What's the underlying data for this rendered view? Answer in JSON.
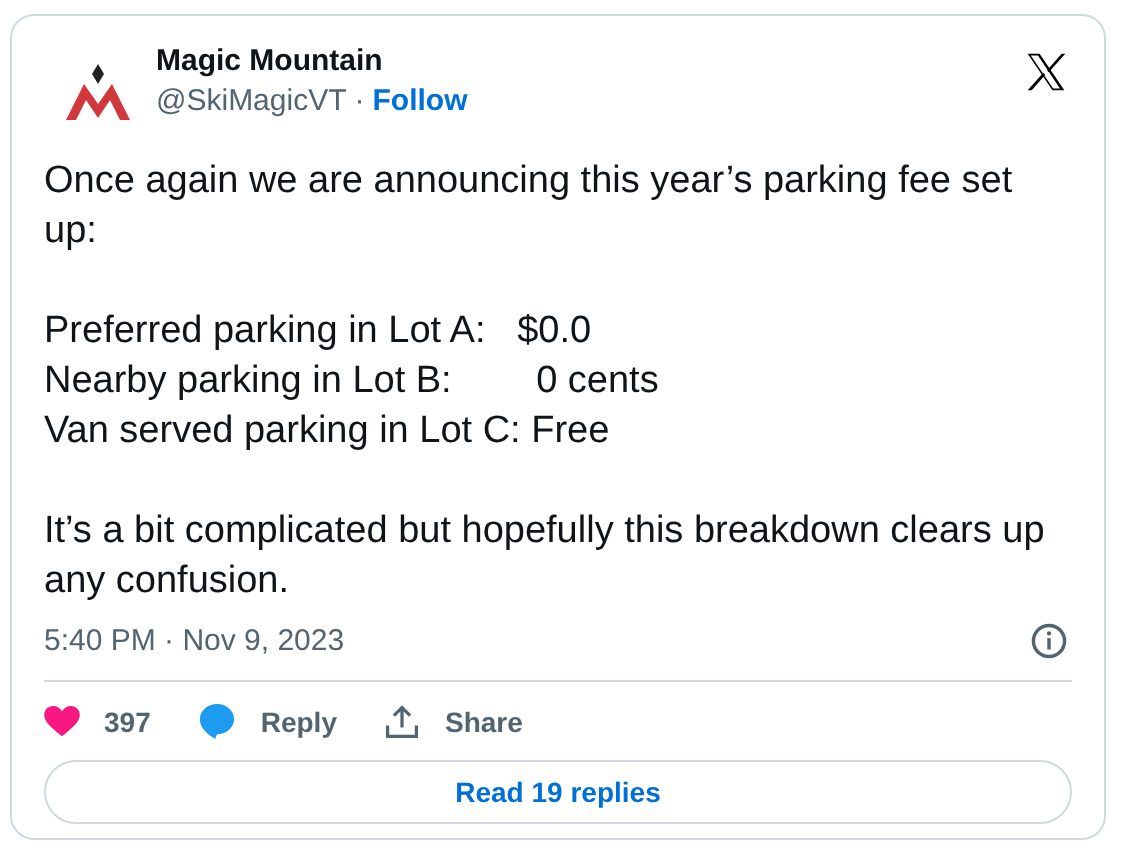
{
  "author": {
    "name": "Magic Mountain",
    "handle": "@SkiMagicVT",
    "separator": "·",
    "follow": "Follow"
  },
  "body": [
    [
      "Once again we are announcing this year’s parking fee set up:"
    ],
    [
      "Preferred parking in Lot A:   $0.0",
      "Nearby parking in Lot B:        0 cents",
      "Van served parking in Lot C: Free"
    ],
    [
      "It’s a bit complicated but hopefully this breakdown clears up any confusion."
    ]
  ],
  "timestamp": "5:40 PM · Nov 9, 2023",
  "actions": [
    {
      "kind": "like",
      "label": "397"
    },
    {
      "kind": "reply",
      "label": "Reply"
    },
    {
      "kind": "share",
      "label": "Share"
    }
  ],
  "read_replies": "Read 19 replies"
}
